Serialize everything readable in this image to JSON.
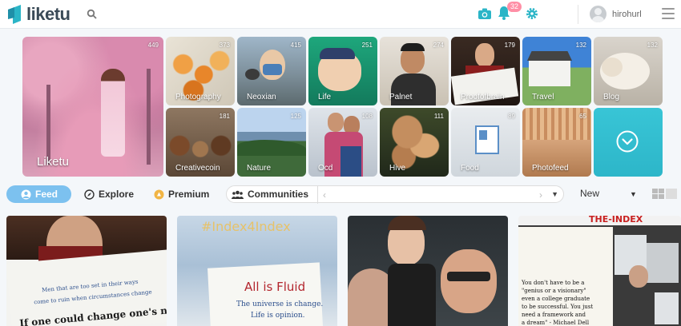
{
  "header": {
    "brand": "liketu",
    "notification_count": "32",
    "username": "hirohurl"
  },
  "featured": {
    "label": "Liketu",
    "count": "449"
  },
  "communities": [
    {
      "label": "Photography",
      "count": "373"
    },
    {
      "label": "Neoxian",
      "count": "415"
    },
    {
      "label": "Life",
      "count": "251"
    },
    {
      "label": "Palnet",
      "count": "274"
    },
    {
      "label": "Proofofbrain",
      "count": "179"
    },
    {
      "label": "Travel",
      "count": "132"
    },
    {
      "label": "Blog",
      "count": "132"
    },
    {
      "label": "Creativecoin",
      "count": "181"
    },
    {
      "label": "Nature",
      "count": "125"
    },
    {
      "label": "Ocd",
      "count": "108"
    },
    {
      "label": "Hive",
      "count": "111"
    },
    {
      "label": "Food",
      "count": "89"
    },
    {
      "label": "Photofeed",
      "count": "65"
    }
  ],
  "tabs": {
    "feed": "Feed",
    "explore": "Explore",
    "premium": "Premium",
    "communities": "Communities",
    "sort": "New"
  },
  "posts": [
    {
      "caption_1": "Men that are too set in their ways",
      "caption_2": "come to ruin when circumstances change",
      "caption_3": "If one could change one's nature"
    },
    {
      "caption_1": "#Index4Index",
      "caption_2": "All is Fluid",
      "caption_3": "The universe is change.",
      "caption_4": "Life is opinion."
    },
    {},
    {
      "caption_1": "THE-INDEX",
      "caption_2": "You don't have to be a",
      "caption_3": "\"genius or a visionary\"",
      "caption_4": "even a college graduate",
      "caption_5": "to be successful. You just",
      "caption_6": "need a framework and",
      "caption_7": "a dream\" - Michael Dell"
    }
  ],
  "colors": {
    "accent": "#7cc1ef",
    "teal": "#2db6c9",
    "badge": "#ff8fa6"
  }
}
